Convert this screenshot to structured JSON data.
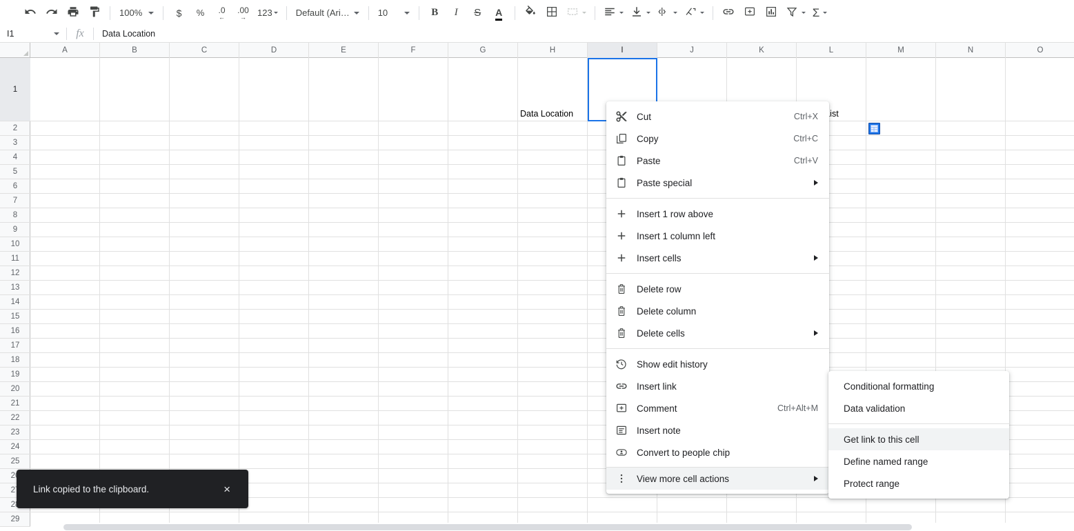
{
  "toolbar": {
    "undo": "undo-icon",
    "redo": "redo-icon",
    "print": "print-icon",
    "paint_format": "paint-format-icon",
    "zoom": "100%",
    "currency": "$",
    "percent": "%",
    "decrease_decimal": ".0",
    "increase_decimal": ".00",
    "number_format": "123",
    "font": "Default (Ari…",
    "font_size": "10",
    "bold": "B",
    "italic": "I",
    "strikethrough": "S",
    "text_color": "A",
    "fill_color": "fill-color-icon",
    "borders": "borders-icon",
    "merge_cells": "merge-cells-icon",
    "horizontal_align": "horizontal-align-icon",
    "vertical_align": "vertical-align-icon",
    "text_wrap": "text-wrap-icon",
    "text_rotation": "text-rotation-icon",
    "insert_link": "link-icon",
    "insert_comment": "comment-icon",
    "insert_chart": "chart-icon",
    "create_filter": "filter-icon",
    "functions": "sigma-icon"
  },
  "formula_bar": {
    "name_box": "I1",
    "fx": "fx",
    "value": "Data Location"
  },
  "grid": {
    "columns": [
      "A",
      "B",
      "C",
      "D",
      "E",
      "F",
      "G",
      "H",
      "I",
      "J",
      "K",
      "L",
      "M",
      "N",
      "O"
    ],
    "selected_column": "I",
    "rows": [
      "1",
      "2",
      "3",
      "4",
      "5",
      "6",
      "7",
      "8",
      "9",
      "10",
      "11",
      "12",
      "13",
      "14",
      "15",
      "16",
      "17",
      "18",
      "19",
      "20",
      "21",
      "22",
      "23",
      "24",
      "25",
      "26",
      "27",
      "28",
      "29"
    ],
    "selected_row": "1",
    "cells": [
      {
        "ref": "I1",
        "text": "Data Location",
        "col": 8,
        "row": 1
      },
      {
        "ref": "M1",
        "text": "Image List",
        "col": 12,
        "row": 1
      }
    ],
    "image_chip": {
      "ref": "M2",
      "icon": "image-chip-icon"
    },
    "selection": {
      "ref": "I1",
      "color": "#1a73e8"
    }
  },
  "context_menu": {
    "groups": [
      {
        "items": [
          {
            "label": "Cut",
            "shortcut": "Ctrl+X",
            "icon": "scissors-icon",
            "submenu": false
          },
          {
            "label": "Copy",
            "shortcut": "Ctrl+C",
            "icon": "copy-icon",
            "submenu": false
          },
          {
            "label": "Paste",
            "shortcut": "Ctrl+V",
            "icon": "clipboard-icon",
            "submenu": false
          },
          {
            "label": "Paste special",
            "shortcut": "",
            "icon": "clipboard-special-icon",
            "submenu": true
          }
        ]
      },
      {
        "items": [
          {
            "label": "Insert 1 row above",
            "shortcut": "",
            "icon": "plus-icon",
            "submenu": false
          },
          {
            "label": "Insert 1 column left",
            "shortcut": "",
            "icon": "plus-icon",
            "submenu": false
          },
          {
            "label": "Insert cells",
            "shortcut": "",
            "icon": "plus-icon",
            "submenu": true
          }
        ]
      },
      {
        "items": [
          {
            "label": "Delete row",
            "shortcut": "",
            "icon": "trash-icon",
            "submenu": false
          },
          {
            "label": "Delete column",
            "shortcut": "",
            "icon": "trash-icon",
            "submenu": false
          },
          {
            "label": "Delete cells",
            "shortcut": "",
            "icon": "trash-icon",
            "submenu": true
          }
        ]
      },
      {
        "items": [
          {
            "label": "Show edit history",
            "shortcut": "",
            "icon": "history-icon",
            "submenu": false
          },
          {
            "label": "Insert link",
            "shortcut": "",
            "icon": "link-icon",
            "submenu": false
          },
          {
            "label": "Comment",
            "shortcut": "Ctrl+Alt+M",
            "icon": "comment-add-icon",
            "submenu": false
          },
          {
            "label": "Insert note",
            "shortcut": "",
            "icon": "note-icon",
            "submenu": false
          },
          {
            "label": "Convert to people chip",
            "shortcut": "",
            "icon": "person-chip-icon",
            "submenu": false
          }
        ]
      },
      {
        "items": [
          {
            "label": "View more cell actions",
            "shortcut": "",
            "icon": "more-vert-icon",
            "submenu": true,
            "active": true
          }
        ]
      }
    ]
  },
  "submenu": {
    "groups": [
      {
        "items": [
          {
            "label": "Conditional formatting",
            "active": false
          },
          {
            "label": "Data validation",
            "active": false
          }
        ]
      },
      {
        "items": [
          {
            "label": "Get link to this cell",
            "active": true
          },
          {
            "label": "Define named range",
            "active": false
          },
          {
            "label": "Protect range",
            "active": false
          }
        ]
      }
    ]
  },
  "toast": {
    "message": "Link copied to the clipboard.",
    "close": "×"
  }
}
